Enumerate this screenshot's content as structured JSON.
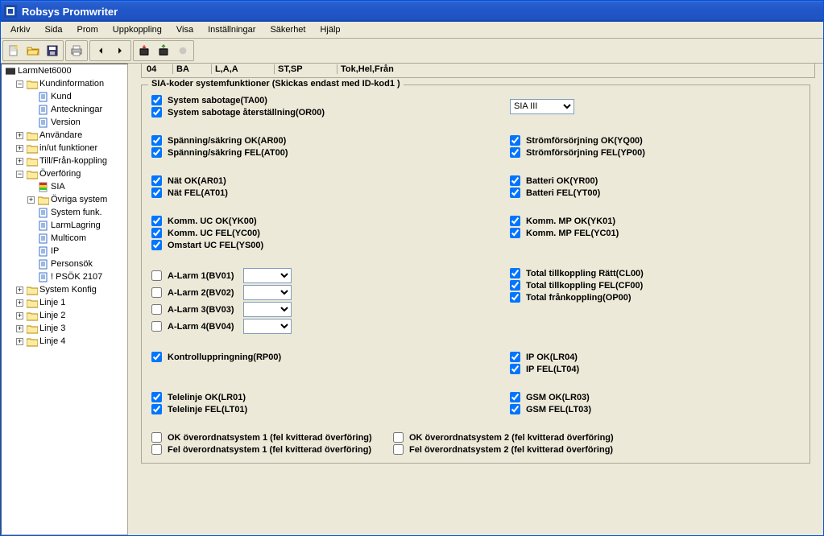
{
  "title": "Robsys Promwriter",
  "menu": [
    "Arkiv",
    "Sida",
    "Prom",
    "Uppkoppling",
    "Visa",
    "Inställningar",
    "Säkerhet",
    "Hjälp"
  ],
  "toprow": {
    "c1": "04",
    "c2": "BA",
    "c3": "L,A,A",
    "c4": "ST,SP",
    "c5": "Tok,Hel,Från"
  },
  "tree": {
    "root": "LarmNet6000",
    "kundinfo": {
      "label": "Kundinformation",
      "children": [
        "Kund",
        "Anteckningar",
        "Version"
      ]
    },
    "anvandare": "Användare",
    "inut": "in/ut funktioner",
    "tillfran": "Till/Från-koppling",
    "overforing": {
      "label": "Överföring",
      "children": [
        {
          "k": "sia",
          "label": "SIA"
        },
        {
          "k": "ovriga",
          "label": "Övriga system",
          "expandable": true
        },
        {
          "k": "sysfunk",
          "label": "System funk."
        },
        {
          "k": "larmlag",
          "label": "LarmLagring"
        },
        {
          "k": "multicom",
          "label": "Multicom"
        },
        {
          "k": "ip",
          "label": "IP"
        },
        {
          "k": "personsok",
          "label": "Personsök"
        },
        {
          "k": "psok",
          "label": "! PSÖK 2107"
        }
      ]
    },
    "systemkonfig": "System Konfig",
    "linje": [
      "Linje 1",
      "Linje 2",
      "Linje 3",
      "Linje 4"
    ]
  },
  "group_title": "SIA-koder systemfunktioner (Skickas endast med ID-kod1 )",
  "sia_select": "SIA III",
  "chk": {
    "sys_sab": "System sabotage(TA00)",
    "sys_sab_rst": "System sabotage återställning(OR00)",
    "span_ok": "Spänning/säkring OK(AR00)",
    "span_fel": "Spänning/säkring FEL(AT00)",
    "strom_ok": "Strömförsörjning OK(YQ00)",
    "strom_fel": "Strömförsörjning FEL(YP00)",
    "nat_ok": "Nät OK(AR01)",
    "nat_fel": "Nät FEL(AT01)",
    "batt_ok": "Batteri OK(YR00)",
    "batt_fel": "Batteri FEL(YT00)",
    "komm_uc_ok": "Komm. UC OK(YK00)",
    "komm_uc_fel": "Komm. UC FEL(YC00)",
    "omstart_uc": "Omstart UC FEL(YS00)",
    "komm_mp_ok": "Komm. MP OK(YK01)",
    "komm_mp_fel": "Komm. MP FEL(YC01)",
    "alarm1": "A-Larm 1(BV01)",
    "alarm2": "A-Larm 2(BV02)",
    "alarm3": "A-Larm 3(BV03)",
    "alarm4": "A-Larm 4(BV04)",
    "tot_ratt": "Total tillkoppling Rätt(CL00)",
    "tot_fel": "Total tillkoppling FEL(CF00)",
    "tot_fran": "Total frånkoppling(OP00)",
    "kontroll": "Kontrolluppringning(RP00)",
    "ip_ok": "IP OK(LR04)",
    "ip_fel": "IP FEL(LT04)",
    "tele_ok": "Telelinje OK(LR01)",
    "tele_fel": "Telelinje FEL(LT01)",
    "gsm_ok": "GSM OK(LR03)",
    "gsm_fel": "GSM FEL(LT03)",
    "ok_over1": "OK  överordnatsystem 1 (fel kvitterad överföring)",
    "ok_over2": "OK  överordnatsystem 2 (fel kvitterad överföring)",
    "fel_over1": "Fel överordnatsystem 1 (fel kvitterad överföring)",
    "fel_over2": "Fel överordnatsystem 2 (fel kvitterad överföring)"
  }
}
